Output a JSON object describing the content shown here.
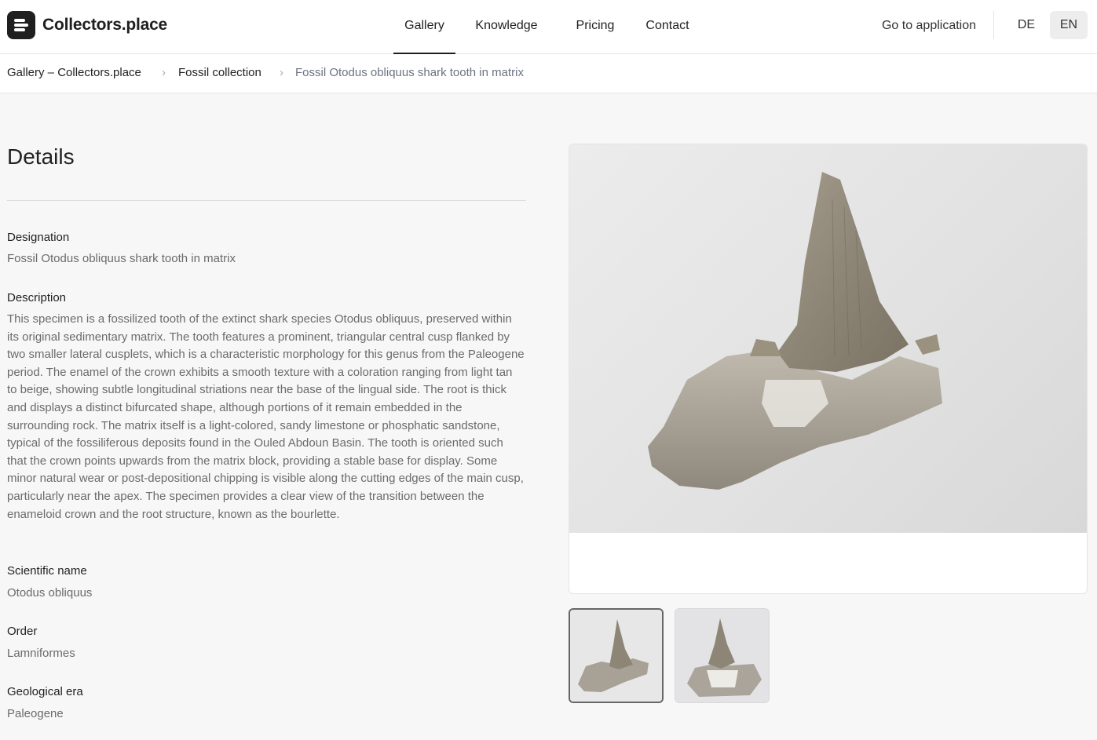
{
  "header": {
    "brand": "Collectors.place",
    "nav": [
      {
        "label": "Gallery",
        "active": true
      },
      {
        "label": "Knowledge",
        "active": false
      },
      {
        "label": "Pricing",
        "active": false
      },
      {
        "label": "Contact",
        "active": false
      }
    ],
    "cta": "Go to application",
    "languages": [
      {
        "code": "DE",
        "selected": false
      },
      {
        "code": "EN",
        "selected": true
      }
    ]
  },
  "breadcrumb": [
    "Gallery – Collectors.place",
    "Fossil collection",
    "Fossil Otodus obliquus shark tooth in matrix"
  ],
  "details": {
    "title": "Details",
    "designation_label": "Designation",
    "designation": "Fossil Otodus obliquus shark tooth in matrix",
    "description_label": "Description",
    "description": "This specimen is a fossilized tooth of the extinct shark species Otodus obliquus, preserved within its original sedimentary matrix. The tooth features a prominent, triangular central cusp flanked by two smaller lateral cusplets, which is a characteristic morphology for this genus from the Paleogene period. The enamel of the crown exhibits a smooth texture with a coloration ranging from light tan to beige, showing subtle longitudinal striations near the base of the lingual side. The root is thick and displays a distinct bifurcated shape, although portions of it remain embedded in the surrounding rock. The matrix itself is a light-colored, sandy limestone or phosphatic sandstone, typical of the fossiliferous deposits found in the Ouled Abdoun Basin. The tooth is oriented such that the crown points upwards from the matrix block, providing a stable base for display. Some minor natural wear or post-depositional chipping is visible along the cutting edges of the main cusp, particularly near the apex. The specimen provides a clear view of the transition between the enameloid crown and the root structure, known as the bourlette.",
    "scientific_name_label": "Scientific name",
    "scientific_name": "Otodus obliquus",
    "order_label": "Order",
    "order": "Lamniformes",
    "era_label": "Geological era",
    "era": "Paleogene"
  },
  "gallery": {
    "thumbnails_count": 2,
    "selected_thumbnail": 1
  },
  "colors": {
    "accent": "#1f1f1f",
    "background": "#f7f7f7",
    "muted_text": "#6b6b6b"
  }
}
